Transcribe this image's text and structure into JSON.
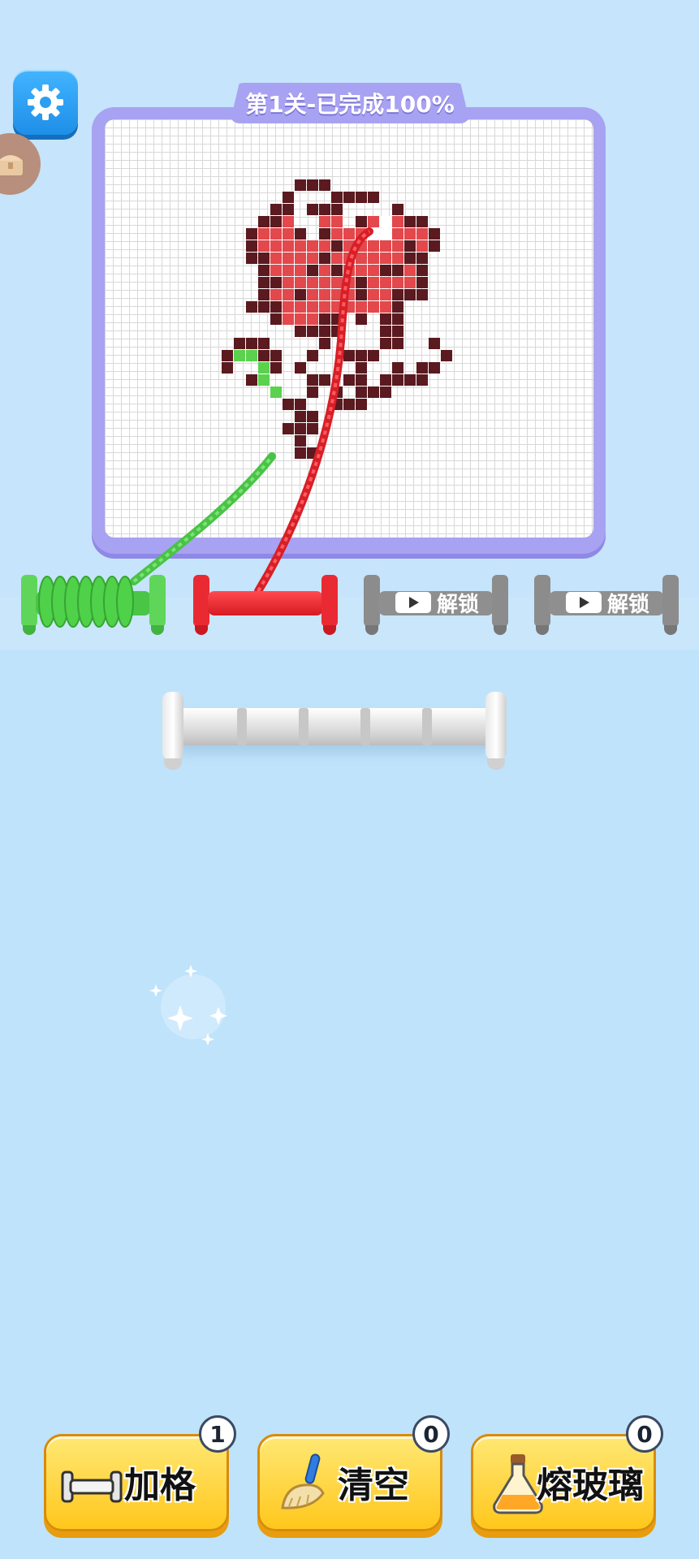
{
  "level": {
    "title": "第1关-已完成100%"
  },
  "spools": [
    {
      "state": "in-use",
      "color": "#4fd14a"
    },
    {
      "state": "in-use",
      "color": "#e8242c"
    },
    {
      "state": "locked",
      "label": "解锁"
    },
    {
      "state": "locked",
      "label": "解锁"
    }
  ],
  "tools": [
    {
      "label": "加格",
      "count": "1",
      "icon": "add-slot-icon"
    },
    {
      "label": "清空",
      "count": "0",
      "icon": "broom-icon"
    },
    {
      "label": "熔玻璃",
      "count": "0",
      "icon": "potion-icon"
    }
  ],
  "colors": {
    "dark": "#5a1a1f",
    "red": "#e2484c",
    "green": "#5ad24e",
    "board_border": "#a8a2f2",
    "button": "#ffd23a"
  }
}
